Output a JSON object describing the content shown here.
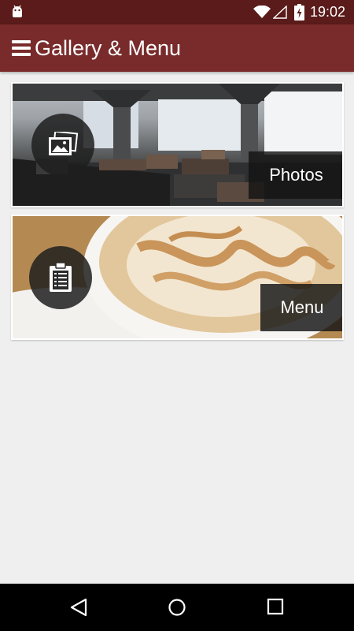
{
  "status_bar": {
    "time": "19:02",
    "icons": [
      "android-icon",
      "wifi-icon",
      "signal-icon",
      "battery-charging-icon"
    ]
  },
  "app_bar": {
    "title": "Gallery & Menu",
    "nav_icon": "hamburger-menu-icon",
    "color": "#792b2b"
  },
  "cards": [
    {
      "label": "Photos",
      "icon": "image-icon"
    },
    {
      "label": "Menu",
      "icon": "clipboard-icon"
    }
  ],
  "nav_bar": {
    "icons": [
      "back-icon",
      "home-icon",
      "recents-icon"
    ]
  },
  "colors": {
    "status_bar": "#5a1b1a",
    "app_bar": "#792b2b",
    "background": "#efefef"
  }
}
